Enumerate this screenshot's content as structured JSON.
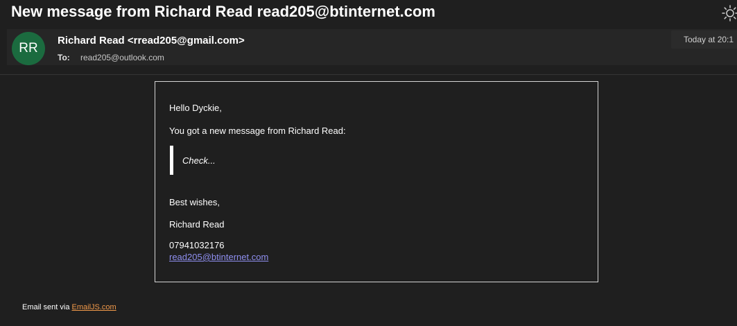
{
  "email": {
    "subject": "New message from Richard Read read205@btinternet.com",
    "sender": {
      "initials": "RR",
      "display": "Richard Read <rread205@gmail.com>",
      "avatar_color": "#1b6b3f"
    },
    "to_label": "To:",
    "to_value": "read205@outlook.com",
    "time": "Today at 20:1"
  },
  "body": {
    "greeting": "Hello Dyckie,",
    "intro": "You got a new message from Richard Read:",
    "quote": "Check...",
    "closing": "Best wishes,",
    "signature_name": "Richard Read",
    "phone": "07941032176",
    "email_link": "read205@btinternet.com",
    "link_color": "#8f8ff0"
  },
  "footer": {
    "text": "Email sent via ",
    "link": "EmailJS.com",
    "link_color": "#f29a4a"
  },
  "icons": {
    "theme": "sun-icon"
  }
}
